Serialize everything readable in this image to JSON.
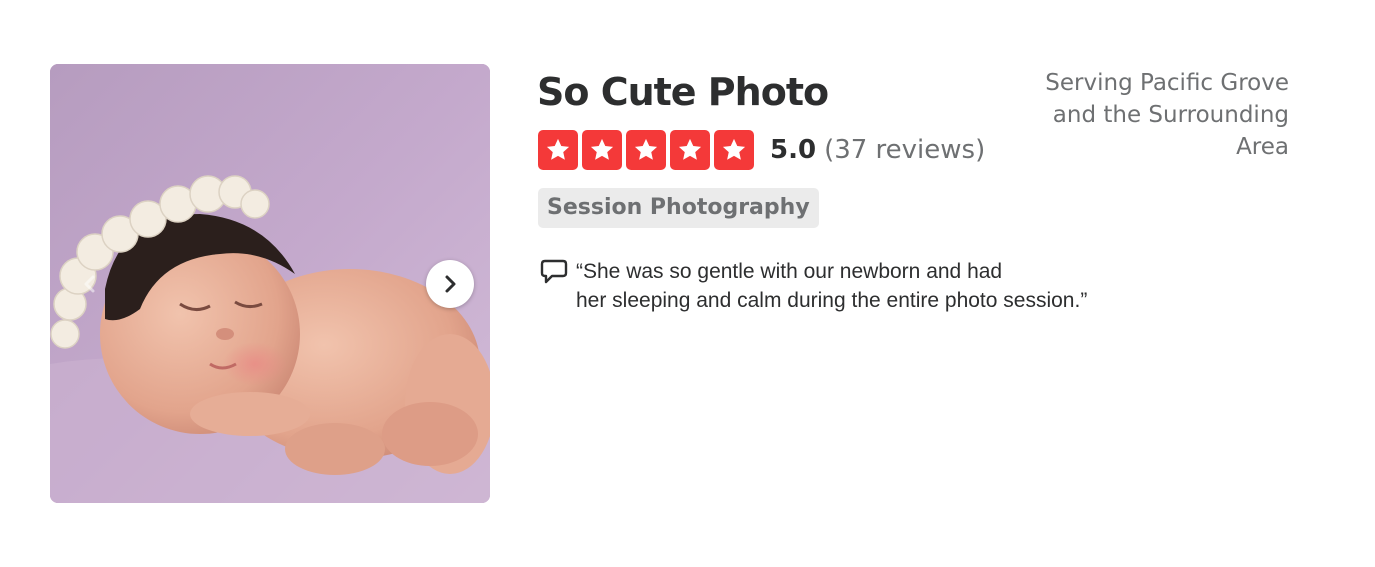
{
  "business": {
    "name": "So Cute Photo",
    "rating_value": "5.0",
    "rating_stars": 5,
    "review_count_text": "(37 reviews)",
    "category": "Session Photography",
    "service_area_lines": [
      "Serving Pacific Grove",
      "and the Surrounding",
      "Area"
    ],
    "snippet_lines": [
      "“She was so gentle with our newborn and had",
      "her sleeping and calm during the entire photo session.”"
    ]
  },
  "colors": {
    "star_red": "#f43939",
    "title_text": "#2d2e2f",
    "muted_text": "#6e7072",
    "tag_background": "#ebebeb"
  },
  "icons": {
    "next": "chevron-right-icon",
    "previous": "chevron-left-icon",
    "star": "star-icon",
    "snippet": "speech-bubble-icon"
  }
}
